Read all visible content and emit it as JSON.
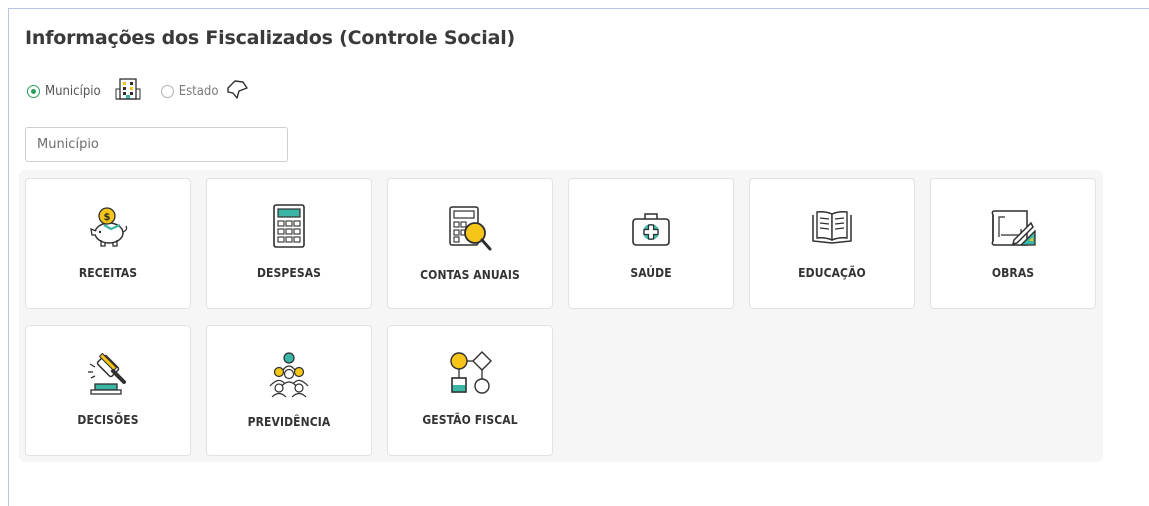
{
  "page": {
    "title": "Informações dos Fiscalizados (Controle Social)"
  },
  "scope": {
    "options": [
      {
        "label": "Município",
        "selected": true,
        "icon": "building-icon"
      },
      {
        "label": "Estado",
        "selected": false,
        "icon": "map-icon"
      }
    ]
  },
  "search": {
    "placeholder": "Município",
    "value": ""
  },
  "cards": [
    {
      "label": "RECEITAS",
      "icon": "piggy-bank-icon"
    },
    {
      "label": "DESPESAS",
      "icon": "calculator-icon"
    },
    {
      "label": "CONTAS ANUAIS",
      "icon": "calculator-magnifier-icon"
    },
    {
      "label": "SAÚDE",
      "icon": "medical-kit-icon"
    },
    {
      "label": "EDUCAÇÃO",
      "icon": "book-icon"
    },
    {
      "label": "OBRAS",
      "icon": "blueprint-icon"
    },
    {
      "label": "DECISÕES",
      "icon": "gavel-icon"
    },
    {
      "label": "PREVIDÊNCIA",
      "icon": "people-group-icon"
    },
    {
      "label": "GESTÃO FISCAL",
      "icon": "flowchart-icon"
    }
  ],
  "colors": {
    "accent_yellow": "#f5c518",
    "accent_teal": "#3ab5a6",
    "outline": "#2f2f2f",
    "radio_selected": "#2a9d5c"
  }
}
